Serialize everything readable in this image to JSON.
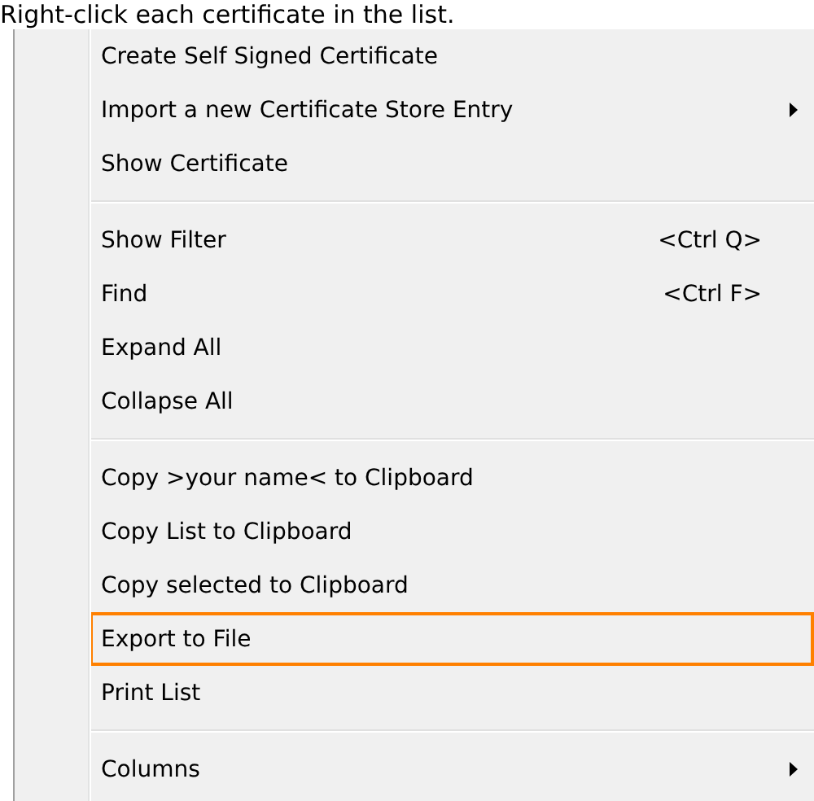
{
  "heading": "Right-click each certificate in the list.",
  "menu": [
    {
      "kind": "item",
      "label": "Create Self Signed Certificate",
      "submenu": false,
      "selected": false
    },
    {
      "kind": "item",
      "label": "Import a new Certificate Store Entry",
      "submenu": true,
      "selected": false
    },
    {
      "kind": "item",
      "label": "Show Certificate",
      "submenu": false,
      "selected": false
    },
    {
      "kind": "separator"
    },
    {
      "kind": "item",
      "label": "Show Filter",
      "shortcut": "<Ctrl Q>",
      "submenu": false,
      "selected": false
    },
    {
      "kind": "item",
      "label": "Find",
      "shortcut": "<Ctrl F>",
      "submenu": false,
      "selected": false
    },
    {
      "kind": "item",
      "label": "Expand All",
      "submenu": false,
      "selected": false
    },
    {
      "kind": "item",
      "label": "Collapse All",
      "submenu": false,
      "selected": false
    },
    {
      "kind": "separator"
    },
    {
      "kind": "item",
      "label": "Copy >your name< to Clipboard",
      "submenu": false,
      "selected": false
    },
    {
      "kind": "item",
      "label": "Copy List to Clipboard",
      "submenu": false,
      "selected": false
    },
    {
      "kind": "item",
      "label": "Copy selected to Clipboard",
      "submenu": false,
      "selected": false
    },
    {
      "kind": "item",
      "label": "Export to File",
      "submenu": false,
      "selected": true
    },
    {
      "kind": "item",
      "label": "Print List",
      "submenu": false,
      "selected": false
    },
    {
      "kind": "separator"
    },
    {
      "kind": "item",
      "label": "Columns",
      "submenu": true,
      "selected": false
    }
  ]
}
